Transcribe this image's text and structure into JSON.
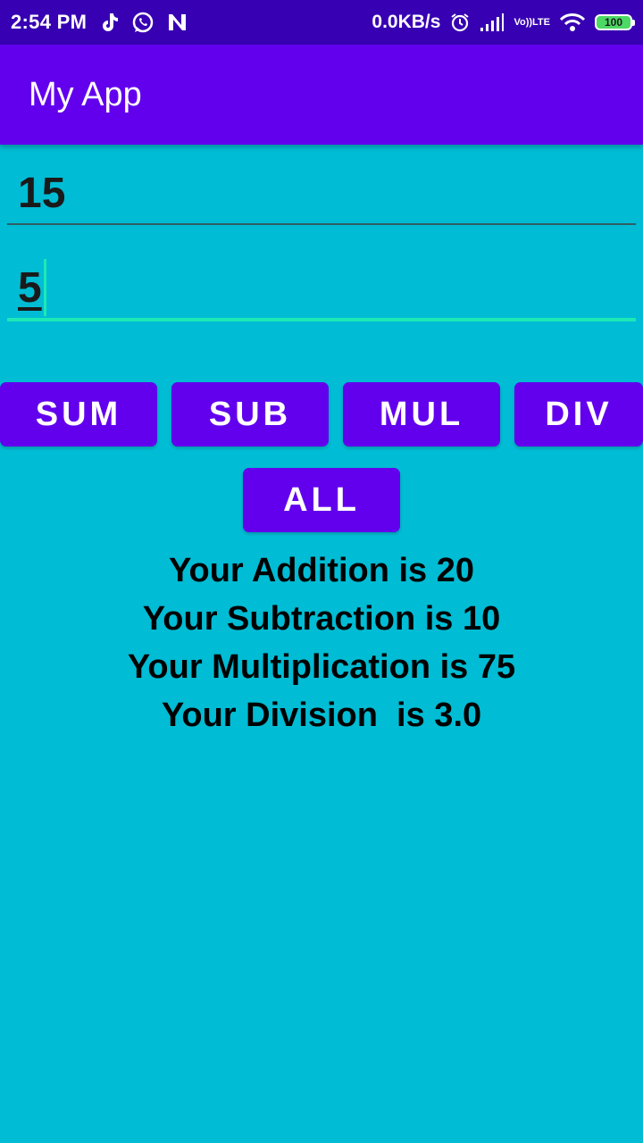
{
  "status_bar": {
    "time": "2:54 PM",
    "left_icons": [
      "tiktok-icon",
      "whatsapp-icon",
      "notification-n-icon"
    ],
    "net_speed": "0.0KB/s",
    "volte_top": "Vo))",
    "volte_bottom": "LTE",
    "battery": "100"
  },
  "app_bar": {
    "title": "My App"
  },
  "inputs": {
    "first_value": "15",
    "second_value": "5"
  },
  "buttons": {
    "sum": "SUM",
    "sub": "SUB",
    "mul": "MUL",
    "div": "DIV",
    "all": "ALL"
  },
  "results": {
    "addition": "Your Addition is 20",
    "subtraction": "Your Subtraction is 10",
    "multiplication": "Your Multiplication is 75",
    "division": "Your Division  is 3.0"
  },
  "colors": {
    "status_bar": "#3700B3",
    "app_bar": "#6200EE",
    "background": "#00BCD4",
    "button": "#6200EE",
    "focus_accent": "#1DE9B6"
  }
}
